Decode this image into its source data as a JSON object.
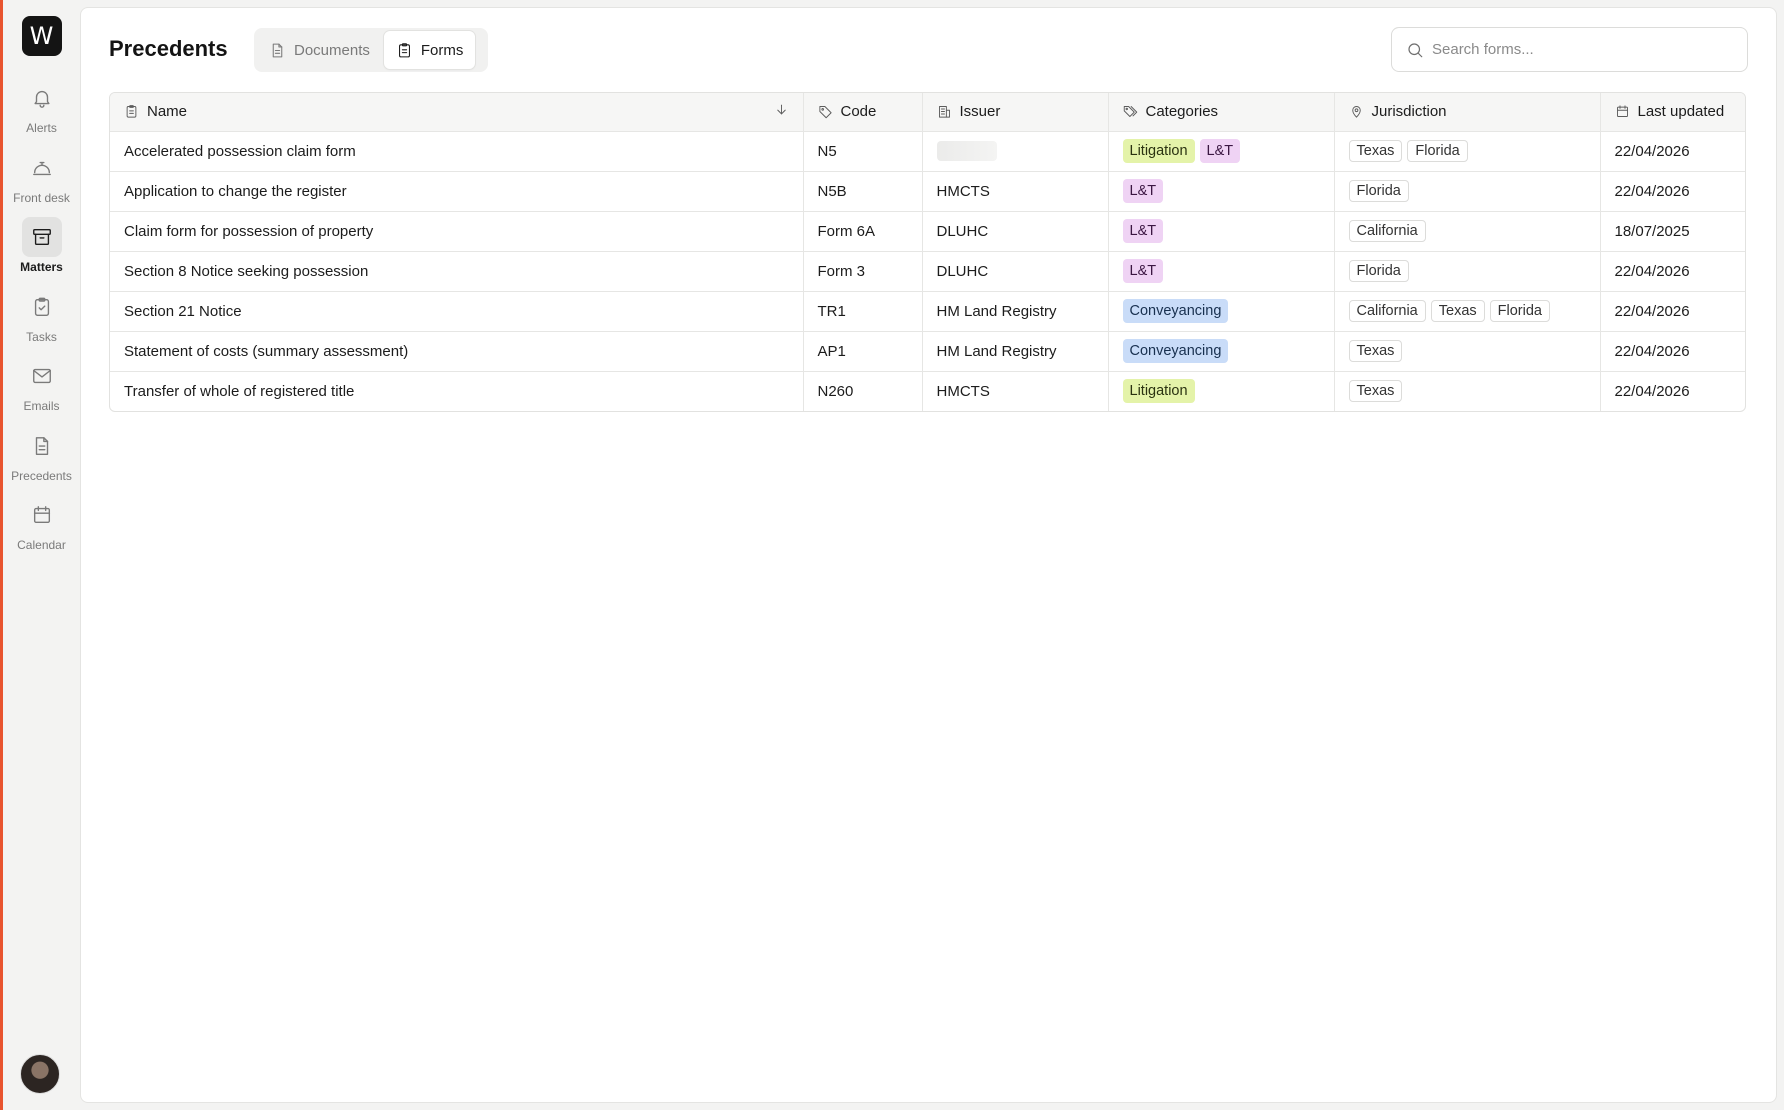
{
  "app": {
    "logo_letter": "W",
    "accent_color": "#e8542f"
  },
  "sidebar": {
    "items": [
      {
        "label": "Alerts",
        "icon": "bell-icon"
      },
      {
        "label": "Front desk",
        "icon": "service-bell-icon"
      },
      {
        "label": "Matters",
        "icon": "archive-box-icon",
        "active": true
      },
      {
        "label": "Tasks",
        "icon": "clipboard-check-icon"
      },
      {
        "label": "Emails",
        "icon": "envelope-icon"
      },
      {
        "label": "Precedents",
        "icon": "document-icon"
      },
      {
        "label": "Calendar",
        "icon": "calendar-icon"
      }
    ]
  },
  "header": {
    "title": "Precedents",
    "tabs": [
      {
        "label": "Documents",
        "icon": "document-icon",
        "active": false
      },
      {
        "label": "Forms",
        "icon": "clipboard-icon",
        "active": true
      }
    ],
    "search_placeholder": "Search forms..."
  },
  "table": {
    "columns": [
      {
        "label": "Name",
        "icon": "clipboard-icon",
        "sorted": "descending"
      },
      {
        "label": "Code",
        "icon": "tag-icon"
      },
      {
        "label": "Issuer",
        "icon": "building-icon"
      },
      {
        "label": "Categories",
        "icon": "tags-icon"
      },
      {
        "label": "Jurisdiction",
        "icon": "map-pin-icon"
      },
      {
        "label": "Last updated",
        "icon": "calendar-icon"
      }
    ],
    "category_colors": {
      "Litigation": "#e4f3a9",
      "L&T": "#efd3f4",
      "Conveyancing": "#c9dcf8"
    },
    "rows": [
      {
        "name": "Accelerated possession claim form",
        "code": "N5",
        "issuer": "",
        "issuer_loading": true,
        "categories": [
          "Litigation",
          "L&T"
        ],
        "jurisdictions": [
          "Texas",
          "Florida"
        ],
        "updated": "22/04/2026"
      },
      {
        "name": "Application to change the register",
        "code": "N5B",
        "issuer": "HMCTS",
        "categories": [
          "L&T"
        ],
        "jurisdictions": [
          "Florida"
        ],
        "updated": "22/04/2026"
      },
      {
        "name": "Claim form for possession of property",
        "code": "Form 6A",
        "issuer": "DLUHC",
        "categories": [
          "L&T"
        ],
        "jurisdictions": [
          "California"
        ],
        "updated": "18/07/2025"
      },
      {
        "name": "Section 8 Notice seeking possession",
        "code": "Form 3",
        "issuer": "DLUHC",
        "categories": [
          "L&T"
        ],
        "jurisdictions": [
          "Florida"
        ],
        "updated": "22/04/2026"
      },
      {
        "name": "Section 21 Notice",
        "code": "TR1",
        "issuer": "HM Land Registry",
        "categories": [
          "Conveyancing"
        ],
        "jurisdictions": [
          "California",
          "Texas",
          "Florida"
        ],
        "updated": "22/04/2026"
      },
      {
        "name": "Statement of costs (summary assessment)",
        "code": "AP1",
        "issuer": "HM Land Registry",
        "categories": [
          "Conveyancing"
        ],
        "jurisdictions": [
          "Texas"
        ],
        "updated": "22/04/2026"
      },
      {
        "name": "Transfer of whole of registered title",
        "code": "N260",
        "issuer": "HMCTS",
        "categories": [
          "Litigation"
        ],
        "jurisdictions": [
          "Texas"
        ],
        "updated": "22/04/2026"
      }
    ]
  }
}
